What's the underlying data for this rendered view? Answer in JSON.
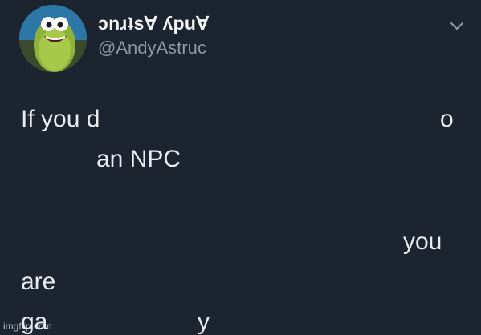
{
  "tweet": {
    "display_name": "ɔnɹʇs∀ ʎpu∀",
    "handle": "@AndyAstruc",
    "text_fragments": [
      "If you d",
      "o",
      "an NPC",
      "you",
      "are",
      "ga",
      "y"
    ]
  },
  "icons": {
    "avatar": "cartoon-fish-avatar",
    "menu": "chevron-down-icon"
  },
  "colors": {
    "background": "#1c2430",
    "text": "#e8ecf0",
    "handle": "#8b98a5"
  },
  "watermark": "imgflip.com"
}
